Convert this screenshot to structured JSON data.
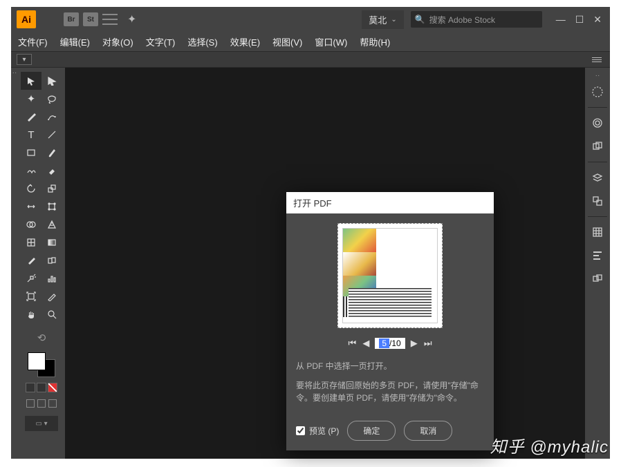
{
  "titlebar": {
    "logo": "Ai",
    "icons": {
      "br": "Br",
      "st": "St"
    },
    "user": "莫北",
    "search_placeholder": "搜索 Adobe Stock"
  },
  "menu": {
    "file": "文件(F)",
    "edit": "编辑(E)",
    "object": "对象(O)",
    "type": "文字(T)",
    "select": "选择(S)",
    "effect": "效果(E)",
    "view": "视图(V)",
    "window": "窗口(W)",
    "help": "帮助(H)"
  },
  "dialog": {
    "title": "打开 PDF",
    "page_current": "5",
    "page_total": "/10",
    "instruction": "从 PDF 中选择一页打开。",
    "help": "要将此页存储回原始的多页 PDF，请使用\"存储\"命令。要创建单页 PDF，请使用\"存储为\"命令。",
    "preview_label": "预览 (P)",
    "ok": "确定",
    "cancel": "取消"
  },
  "watermark": "知乎 @myhalic"
}
